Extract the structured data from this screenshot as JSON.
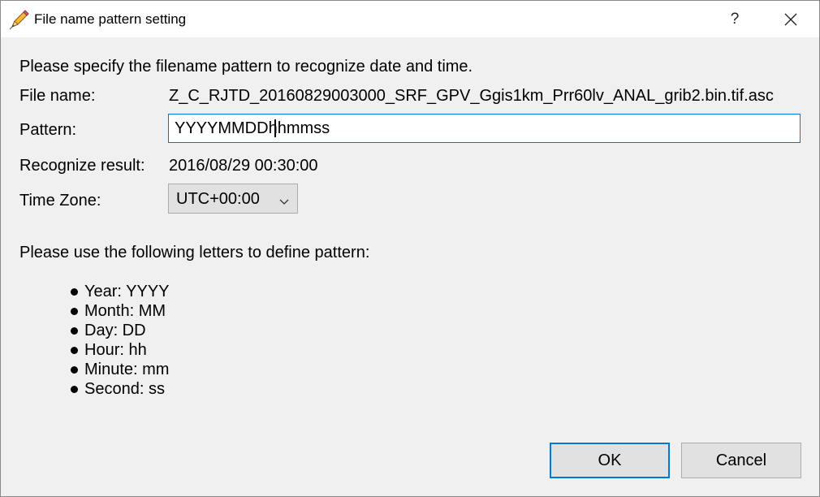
{
  "window": {
    "title": "File name pattern setting",
    "help_label": "?"
  },
  "form": {
    "instruction": "Please specify the filename pattern to recognize date and time.",
    "file_name_label": "File name:",
    "file_name_value": "Z_C_RJTD_20160829003000_SRF_GPV_Ggis1km_Prr60lv_ANAL_grib2.bin.tif.asc",
    "pattern_label": "Pattern:",
    "pattern_value": "YYYYMMDDhhmmss",
    "result_label": "Recognize result:",
    "result_value": "2016/08/29 00:30:00",
    "timezone_label": "Time Zone:",
    "timezone_value": "UTC+00:00"
  },
  "help": {
    "heading": "Please use the following letters to define pattern:",
    "items": [
      "Year: YYYY",
      "Month: MM",
      "Day: DD",
      "Hour: hh",
      "Minute: mm",
      "Second: ss"
    ]
  },
  "buttons": {
    "ok_label": "OK",
    "cancel_label": "Cancel"
  },
  "icons": {
    "title": "pencil-icon",
    "close": "close-icon",
    "dropdown": "chevron-down-icon"
  },
  "colors": {
    "accent": "#0078d7",
    "background": "#f0f0f0",
    "button_face": "#e1e1e1"
  }
}
